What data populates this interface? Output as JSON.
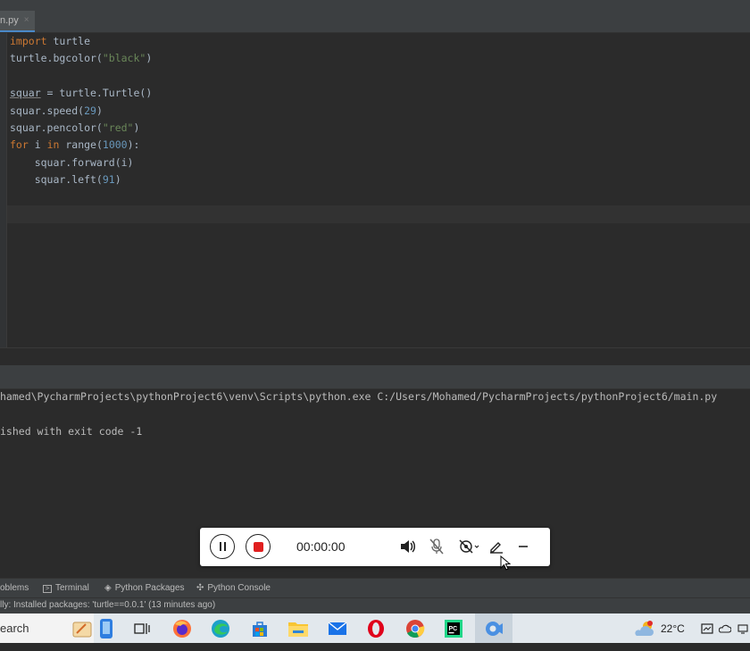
{
  "editor": {
    "tab_label": "n.py",
    "tab_close": "×",
    "lines": [
      [
        {
          "t": "import",
          "c": "kw"
        },
        {
          "t": " turtle",
          "c": ""
        }
      ],
      [
        {
          "t": "turtle.bgcolor(",
          "c": ""
        },
        {
          "t": "\"black\"",
          "c": "str"
        },
        {
          "t": ")",
          "c": ""
        }
      ],
      [],
      [
        {
          "t": "squar",
          "c": "var"
        },
        {
          "t": " = turtle.Turtle()",
          "c": ""
        }
      ],
      [
        {
          "t": "squar.speed(",
          "c": ""
        },
        {
          "t": "29",
          "c": "num"
        },
        {
          "t": ")",
          "c": ""
        }
      ],
      [
        {
          "t": "squar.pencolor(",
          "c": ""
        },
        {
          "t": "\"red\"",
          "c": "str"
        },
        {
          "t": ")",
          "c": ""
        }
      ],
      [
        {
          "t": "for",
          "c": "kw"
        },
        {
          "t": " i ",
          "c": ""
        },
        {
          "t": "in",
          "c": "kw"
        },
        {
          "t": " range(",
          "c": ""
        },
        {
          "t": "1000",
          "c": "num"
        },
        {
          "t": "):",
          "c": ""
        }
      ],
      [
        {
          "t": "    squar.forward(i)",
          "c": ""
        }
      ],
      [
        {
          "t": "    squar.left(",
          "c": ""
        },
        {
          "t": "91",
          "c": "num"
        },
        {
          "t": ")",
          "c": ""
        }
      ]
    ]
  },
  "console": {
    "command": "hamed\\PycharmProjects\\pythonProject6\\venv\\Scripts\\python.exe C:/Users/Mohamed/PycharmProjects/pythonProject6/main.py",
    "exit_message": "ished with exit code -1"
  },
  "recorder": {
    "timer": "00:00:00"
  },
  "tool_windows": [
    {
      "label": "oblems",
      "icon": "problems-icon"
    },
    {
      "label": "Terminal",
      "icon": "terminal-icon"
    },
    {
      "label": "Python Packages",
      "icon": "packages-icon"
    },
    {
      "label": "Python Console",
      "icon": "python-console-icon"
    }
  ],
  "statusbar": {
    "message": "lly: Installed packages: 'turtle==0.0.1' (13 minutes ago)"
  },
  "taskbar": {
    "search_label": "earch",
    "temperature": "22°C"
  },
  "colors": {
    "editor_bg": "#2b2b2b",
    "keyword": "#cc7832",
    "string": "#6a8759",
    "number": "#6897bb",
    "stop_red": "#e01f1f"
  }
}
